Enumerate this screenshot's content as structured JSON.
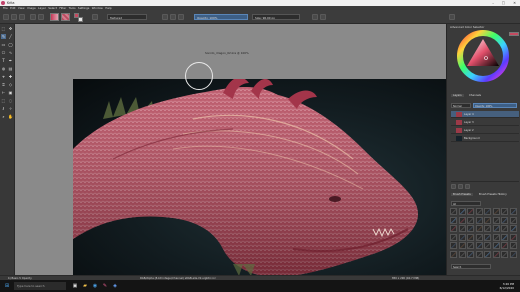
{
  "window": {
    "title": "Krita",
    "min": "–",
    "max": "□",
    "close": "✕"
  },
  "menu": [
    "File",
    "Edit",
    "View",
    "Image",
    "Layer",
    "Select",
    "Filter",
    "Tools",
    "Settings",
    "Window",
    "Help"
  ],
  "options": {
    "brush_preset": "Textured",
    "opacity": "Opacity: 100%",
    "size": "Size: 96.00 px"
  },
  "canvas": {
    "doc_title": "Sonido_dragon_02.kra  @  100%"
  },
  "docker": {
    "color_header": "Advanced Color Selector",
    "tabs": [
      "Layers",
      "Channels"
    ],
    "layers_mode": "Normal",
    "layers_opacity": "Opacity: 100%",
    "layers": [
      {
        "name": "Layer 4",
        "selected": true
      },
      {
        "name": "Layer 3",
        "selected": false
      },
      {
        "name": "Layer 2",
        "selected": false
      },
      {
        "name": "Background",
        "selected": false
      }
    ],
    "brush_tabs": [
      "Brush Presets",
      "Brush Presets History"
    ],
    "brush_tag": "All",
    "brush_search": "Search"
  },
  "status": {
    "left": "b) Basic-5 Opacity",
    "center": "RGB/Alpha (8-bit integer/channel)  sRGB-elle-V2-srgbtrc.icc",
    "right": "850 x 290 (40.7 MiB)"
  },
  "taskbar": {
    "search": "Type here to search",
    "time": "3:26 PM",
    "date": "6/12/2020"
  },
  "colors": {
    "accent": "#3d5f86",
    "dragon": "#b23e52",
    "canvas_bg": "#121c20"
  }
}
